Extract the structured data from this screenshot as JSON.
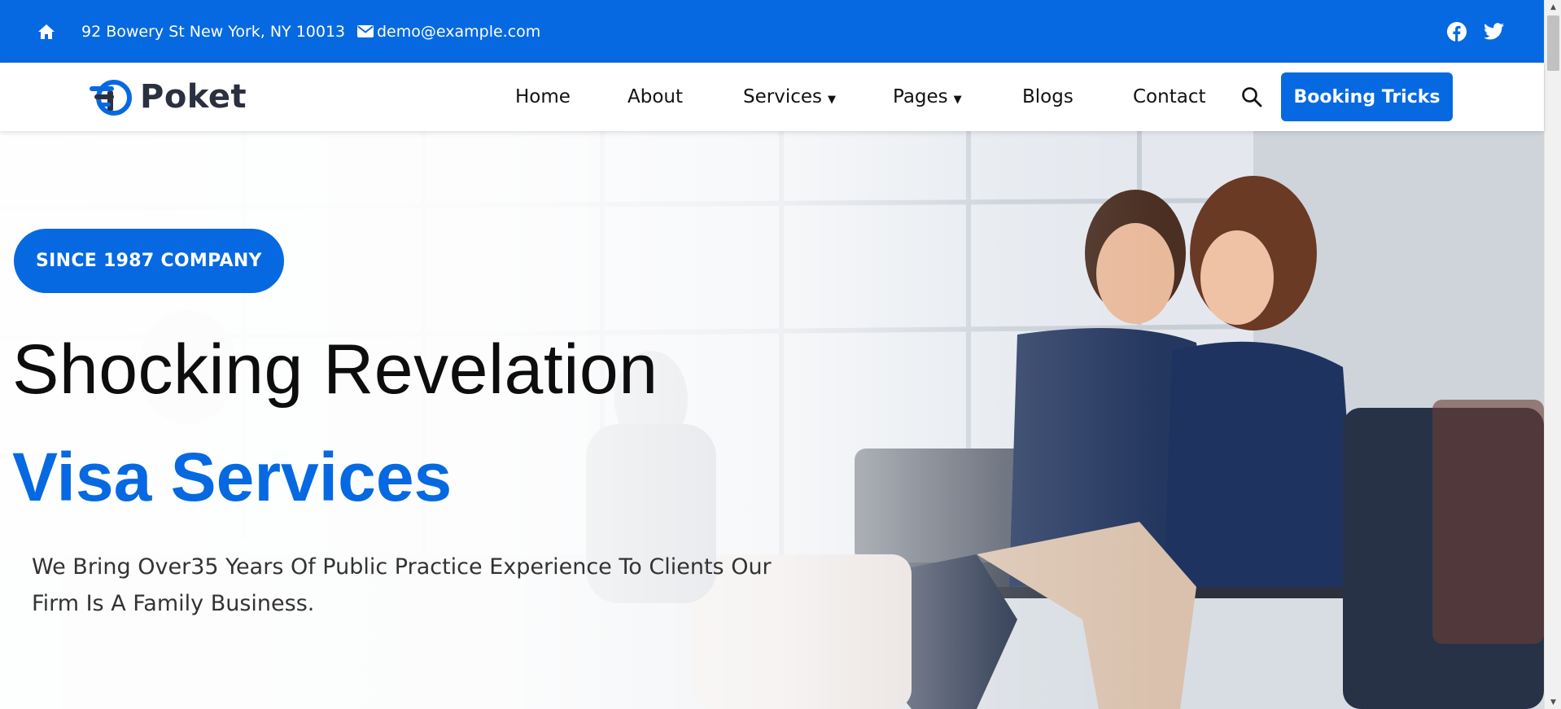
{
  "topbar": {
    "address": "92 Bowery St New York, NY 10013",
    "email": "demo@example.com",
    "icons": [
      "home-icon",
      "envelope-icon",
      "facebook-icon",
      "twitter-icon"
    ]
  },
  "nav": {
    "logo_text": "Poket",
    "items": [
      {
        "label": "Home"
      },
      {
        "label": "About"
      },
      {
        "label": "Services",
        "dropdown": true
      },
      {
        "label": "Pages",
        "dropdown": true
      },
      {
        "label": "Blogs"
      },
      {
        "label": "Contact"
      }
    ],
    "caret": "▼",
    "cta_label": "Booking Tricks"
  },
  "hero": {
    "badge": "SINCE 1987 COMPANY",
    "headline": "Shocking Revelation",
    "highlight": "Visa Services",
    "description": "We Bring Over35 Years Of Public Practice Experience To Clients Our Firm Is A Family Business."
  },
  "scrollbar": {
    "up": "▲",
    "down": "▼"
  },
  "colors": {
    "brand": "#0669e1",
    "text_dark": "#0d0d0d",
    "logo_dark": "#2b3040"
  }
}
